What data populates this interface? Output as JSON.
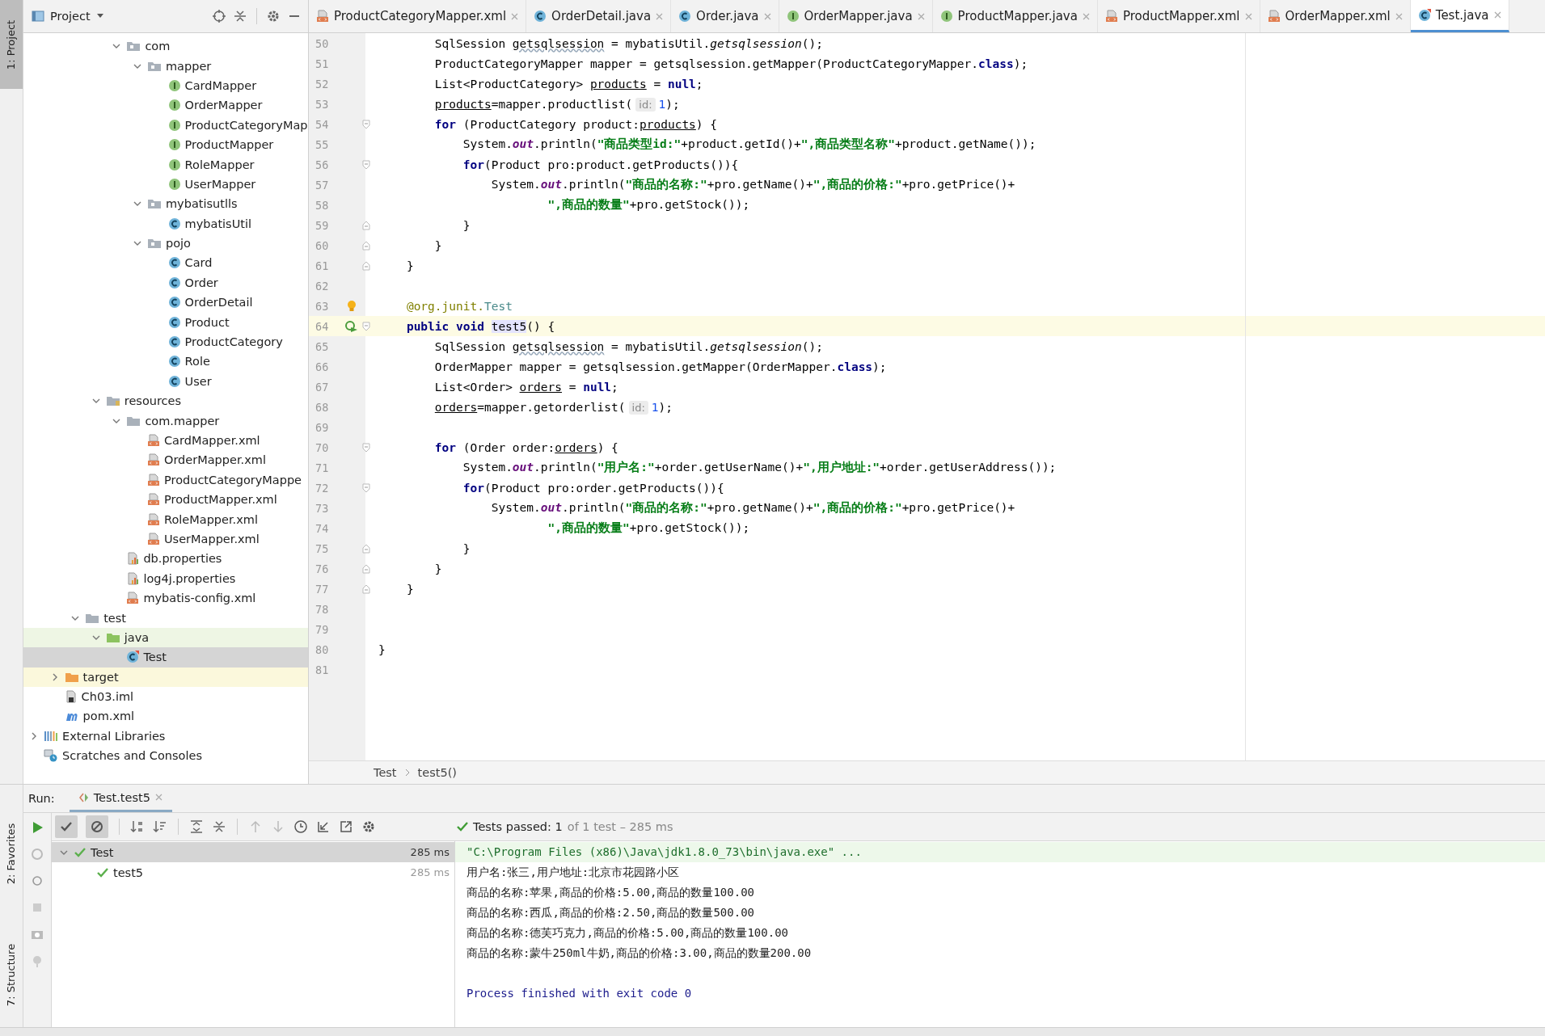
{
  "side_tabs": [
    {
      "label": "1: Project",
      "selected": true
    },
    {
      "label": "2: Favorites",
      "selected": false
    },
    {
      "label": "7: Structure",
      "selected": false
    }
  ],
  "project_panel": {
    "title": "Project",
    "tree": [
      {
        "children": [
          {
            "children": [
              {
                "children": [
                  {
                    "children": [
                      {
                        "label": "com",
                        "kind": "package",
                        "expanded": true,
                        "selected": false,
                        "children": [
                          {
                            "label": "mapper",
                            "kind": "package",
                            "expanded": true,
                            "selected": false,
                            "children": [
                              {
                                "label": "CardMapper",
                                "kind": "interface",
                                "selected": false
                              },
                              {
                                "label": "OrderMapper",
                                "kind": "interface",
                                "selected": false
                              },
                              {
                                "label": "ProductCategoryMap",
                                "kind": "interface",
                                "selected": false
                              },
                              {
                                "label": "ProductMapper",
                                "kind": "interface",
                                "selected": false
                              },
                              {
                                "label": "RoleMapper",
                                "kind": "interface",
                                "selected": false
                              },
                              {
                                "label": "UserMapper",
                                "kind": "interface",
                                "selected": false
                              }
                            ]
                          },
                          {
                            "label": "mybatisutlls",
                            "kind": "package",
                            "expanded": true,
                            "selected": false,
                            "children": [
                              {
                                "label": "mybatisUtil",
                                "kind": "class",
                                "selected": false
                              }
                            ]
                          },
                          {
                            "label": "pojo",
                            "kind": "package",
                            "expanded": true,
                            "selected": false,
                            "children": [
                              {
                                "label": "Card",
                                "kind": "class",
                                "selected": false
                              },
                              {
                                "label": "Order",
                                "kind": "class",
                                "selected": false
                              },
                              {
                                "label": "OrderDetail",
                                "kind": "class",
                                "selected": false
                              },
                              {
                                "label": "Product",
                                "kind": "class",
                                "selected": false
                              },
                              {
                                "label": "ProductCategory",
                                "kind": "class",
                                "selected": false
                              },
                              {
                                "label": "Role",
                                "kind": "class",
                                "selected": false
                              },
                              {
                                "label": "User",
                                "kind": "class",
                                "selected": false
                              }
                            ]
                          }
                        ]
                      }
                    ]
                  },
                  {
                    "label": "resources",
                    "kind": "resources",
                    "expanded": true,
                    "selected": false,
                    "children": [
                      {
                        "label": "com.mapper",
                        "kind": "folder",
                        "expanded": true,
                        "selected": false,
                        "children": [
                          {
                            "label": "CardMapper.xml",
                            "kind": "xml",
                            "selected": false
                          },
                          {
                            "label": "OrderMapper.xml",
                            "kind": "xml",
                            "selected": false
                          },
                          {
                            "label": "ProductCategoryMappe",
                            "kind": "xml",
                            "selected": false
                          },
                          {
                            "label": "ProductMapper.xml",
                            "kind": "xml",
                            "selected": false
                          },
                          {
                            "label": "RoleMapper.xml",
                            "kind": "xml",
                            "selected": false
                          },
                          {
                            "label": "UserMapper.xml",
                            "kind": "xml",
                            "selected": false
                          }
                        ]
                      },
                      {
                        "label": "db.properties",
                        "kind": "properties",
                        "selected": false
                      },
                      {
                        "label": "log4j.properties",
                        "kind": "properties",
                        "selected": false
                      },
                      {
                        "label": "mybatis-config.xml",
                        "kind": "xml",
                        "selected": false
                      }
                    ]
                  }
                ]
              },
              {
                "label": "test",
                "kind": "folder",
                "expanded": true,
                "selected": false,
                "children": [
                  {
                    "label": "java",
                    "kind": "test-root",
                    "expanded": true,
                    "selected": false,
                    "children": [
                      {
                        "label": "Test",
                        "kind": "test-class",
                        "selected": true
                      }
                    ]
                  }
                ]
              }
            ]
          },
          {
            "label": "target",
            "kind": "excluded",
            "expanded": false,
            "selected": false
          },
          {
            "label": "Ch03.iml",
            "kind": "iml",
            "selected": false
          },
          {
            "label": "pom.xml",
            "kind": "maven",
            "selected": false
          }
        ]
      },
      {
        "label": "External Libraries",
        "kind": "libraries",
        "expanded": false,
        "selected": false
      },
      {
        "label": "Scratches and Consoles",
        "kind": "scratches",
        "selected": false
      }
    ]
  },
  "editor_tabs": [
    {
      "label": "ProductCategoryMapper.xml",
      "kind": "xml",
      "selected": false
    },
    {
      "label": "OrderDetail.java",
      "kind": "class",
      "selected": false
    },
    {
      "label": "Order.java",
      "kind": "class",
      "selected": false
    },
    {
      "label": "OrderMapper.java",
      "kind": "interface",
      "selected": false
    },
    {
      "label": "ProductMapper.java",
      "kind": "interface",
      "selected": false
    },
    {
      "label": "ProductMapper.xml",
      "kind": "xml",
      "selected": false
    },
    {
      "label": "OrderMapper.xml",
      "kind": "xml",
      "selected": false
    },
    {
      "label": "Test.java",
      "kind": "test-class",
      "selected": true
    }
  ],
  "code_lines": [
    {
      "number": "50",
      "current": false,
      "tokens": [
        {
          "kind": "plain",
          "text": "        SqlSession "
        },
        {
          "kind": "wavy",
          "text": "getsqlsession"
        },
        {
          "kind": "plain",
          "text": " = mybatisUtil."
        },
        {
          "kind": "static",
          "text": "getsqlsession"
        },
        {
          "kind": "plain",
          "text": "();"
        }
      ]
    },
    {
      "number": "51",
      "current": false,
      "tokens": [
        {
          "kind": "plain",
          "text": "        ProductCategoryMapper mapper = getsqlsession.getMapper(ProductCategoryMapper."
        },
        {
          "kind": "keyword",
          "text": "class"
        },
        {
          "kind": "plain",
          "text": ");"
        }
      ]
    },
    {
      "number": "52",
      "current": false,
      "tokens": [
        {
          "kind": "plain",
          "text": "        List<ProductCategory> "
        },
        {
          "kind": "underline",
          "text": "products"
        },
        {
          "kind": "plain",
          "text": " = "
        },
        {
          "kind": "keyword",
          "text": "null"
        },
        {
          "kind": "plain",
          "text": ";"
        }
      ]
    },
    {
      "number": "53",
      "current": false,
      "tokens": [
        {
          "kind": "underline",
          "text": "        products"
        },
        {
          "kind": "plain",
          "text": "=mapper.productlist("
        },
        {
          "kind": "hint",
          "text": "id:"
        },
        {
          "kind": "number",
          "text": "1"
        },
        {
          "kind": "plain",
          "text": ");"
        }
      ]
    },
    {
      "number": "54",
      "current": false,
      "fold": {
        "kind": "open"
      },
      "tokens": [
        {
          "kind": "keyword",
          "text": "        for"
        },
        {
          "kind": "plain",
          "text": " (ProductCategory product:"
        },
        {
          "kind": "underline",
          "text": "products"
        },
        {
          "kind": "plain",
          "text": ") {"
        }
      ]
    },
    {
      "number": "55",
      "current": false,
      "tokens": [
        {
          "kind": "plain",
          "text": "            System."
        },
        {
          "kind": "field",
          "text": "out"
        },
        {
          "kind": "plain",
          "text": ".println("
        },
        {
          "kind": "string",
          "text": "\"商品类型id:\""
        },
        {
          "kind": "plain",
          "text": "+product.getId()+"
        },
        {
          "kind": "string",
          "text": "\",商品类型名称\""
        },
        {
          "kind": "plain",
          "text": "+product.getName());"
        }
      ]
    },
    {
      "number": "56",
      "current": false,
      "fold": {
        "kind": "open"
      },
      "tokens": [
        {
          "kind": "keyword",
          "text": "            for"
        },
        {
          "kind": "plain",
          "text": "(Product pro:product.getProducts()){"
        }
      ]
    },
    {
      "number": "57",
      "current": false,
      "tokens": [
        {
          "kind": "plain",
          "text": "                System."
        },
        {
          "kind": "field",
          "text": "out"
        },
        {
          "kind": "plain",
          "text": ".println("
        },
        {
          "kind": "string",
          "text": "\"商品的名称:\""
        },
        {
          "kind": "plain",
          "text": "+pro.getName()+"
        },
        {
          "kind": "string",
          "text": "\",商品的价格:\""
        },
        {
          "kind": "plain",
          "text": "+pro.getPrice()+"
        }
      ]
    },
    {
      "number": "58",
      "current": false,
      "tokens": [
        {
          "kind": "string",
          "text": "                        \",商品的数量\""
        },
        {
          "kind": "plain",
          "text": "+pro.getStock());"
        }
      ]
    },
    {
      "number": "59",
      "current": false,
      "fold": {
        "kind": "close"
      },
      "tokens": [
        {
          "kind": "plain",
          "text": "            }"
        }
      ]
    },
    {
      "number": "60",
      "current": false,
      "fold": {
        "kind": "close"
      },
      "tokens": [
        {
          "kind": "plain",
          "text": "        }"
        }
      ]
    },
    {
      "number": "61",
      "current": false,
      "fold": {
        "kind": "close"
      },
      "tokens": [
        {
          "kind": "plain",
          "text": "    }"
        }
      ]
    },
    {
      "number": "62",
      "current": false
    },
    {
      "number": "63",
      "current": false,
      "marker": {
        "kind": "bulb"
      },
      "tokens": [
        {
          "kind": "annotation",
          "text": "    @org.junit."
        },
        {
          "kind": "annotype",
          "text": "Test"
        }
      ]
    },
    {
      "number": "64",
      "current": true,
      "marker": {
        "kind": "run"
      },
      "fold": {
        "kind": "open"
      },
      "tokens": [
        {
          "kind": "keyword",
          "text": "    public void"
        },
        {
          "kind": "highlight",
          "text": " test5"
        },
        {
          "kind": "plain",
          "text": "() {"
        }
      ]
    },
    {
      "number": "65",
      "current": false,
      "tokens": [
        {
          "kind": "plain",
          "text": "        SqlSession "
        },
        {
          "kind": "wavy",
          "text": "getsqlsession"
        },
        {
          "kind": "plain",
          "text": " = mybatisUtil."
        },
        {
          "kind": "static",
          "text": "getsqlsession"
        },
        {
          "kind": "plain",
          "text": "();"
        }
      ]
    },
    {
      "number": "66",
      "current": false,
      "tokens": [
        {
          "kind": "plain",
          "text": "        OrderMapper mapper = getsqlsession.getMapper(OrderMapper."
        },
        {
          "kind": "keyword",
          "text": "class"
        },
        {
          "kind": "plain",
          "text": ");"
        }
      ]
    },
    {
      "number": "67",
      "current": false,
      "tokens": [
        {
          "kind": "plain",
          "text": "        List<Order> "
        },
        {
          "kind": "underline",
          "text": "orders"
        },
        {
          "kind": "plain",
          "text": " = "
        },
        {
          "kind": "keyword",
          "text": "null"
        },
        {
          "kind": "plain",
          "text": ";"
        }
      ]
    },
    {
      "number": "68",
      "current": false,
      "tokens": [
        {
          "kind": "underline",
          "text": "        orders"
        },
        {
          "kind": "plain",
          "text": "=mapper.getorderlist("
        },
        {
          "kind": "hint",
          "text": "id:"
        },
        {
          "kind": "number",
          "text": "1"
        },
        {
          "kind": "plain",
          "text": ");"
        }
      ]
    },
    {
      "number": "69",
      "current": false
    },
    {
      "number": "70",
      "current": false,
      "fold": {
        "kind": "open"
      },
      "tokens": [
        {
          "kind": "keyword",
          "text": "        for"
        },
        {
          "kind": "plain",
          "text": " (Order order:"
        },
        {
          "kind": "underline",
          "text": "orders"
        },
        {
          "kind": "plain",
          "text": ") {"
        }
      ]
    },
    {
      "number": "71",
      "current": false,
      "tokens": [
        {
          "kind": "plain",
          "text": "            System."
        },
        {
          "kind": "field",
          "text": "out"
        },
        {
          "kind": "plain",
          "text": ".println("
        },
        {
          "kind": "string",
          "text": "\"用户名:\""
        },
        {
          "kind": "plain",
          "text": "+order.getUserName()+"
        },
        {
          "kind": "string",
          "text": "\",用户地址:\""
        },
        {
          "kind": "plain",
          "text": "+order.getUserAddress());"
        }
      ]
    },
    {
      "number": "72",
      "current": false,
      "fold": {
        "kind": "open"
      },
      "tokens": [
        {
          "kind": "keyword",
          "text": "            for"
        },
        {
          "kind": "plain",
          "text": "(Product pro:order.getProducts()){"
        }
      ]
    },
    {
      "number": "73",
      "current": false,
      "tokens": [
        {
          "kind": "plain",
          "text": "                System."
        },
        {
          "kind": "field",
          "text": "out"
        },
        {
          "kind": "plain",
          "text": ".println("
        },
        {
          "kind": "string",
          "text": "\"商品的名称:\""
        },
        {
          "kind": "plain",
          "text": "+pro.getName()+"
        },
        {
          "kind": "string",
          "text": "\",商品的价格:\""
        },
        {
          "kind": "plain",
          "text": "+pro.getPrice()+"
        }
      ]
    },
    {
      "number": "74",
      "current": false,
      "tokens": [
        {
          "kind": "string",
          "text": "                        \",商品的数量\""
        },
        {
          "kind": "plain",
          "text": "+pro.getStock());"
        }
      ]
    },
    {
      "number": "75",
      "current": false,
      "fold": {
        "kind": "close"
      },
      "tokens": [
        {
          "kind": "plain",
          "text": "            }"
        }
      ]
    },
    {
      "number": "76",
      "current": false,
      "fold": {
        "kind": "close"
      },
      "tokens": [
        {
          "kind": "plain",
          "text": "        }"
        }
      ]
    },
    {
      "number": "77",
      "current": false,
      "fold": {
        "kind": "close"
      },
      "tokens": [
        {
          "kind": "plain",
          "text": "    }"
        }
      ]
    },
    {
      "number": "78",
      "current": false
    },
    {
      "number": "79",
      "current": false
    },
    {
      "number": "80",
      "current": false,
      "tokens": [
        {
          "kind": "plain",
          "text": "}"
        }
      ]
    },
    {
      "number": "81",
      "current": false
    }
  ],
  "breadcrumb": [
    "Test",
    "test5()"
  ],
  "run_panel": {
    "label": "Run:",
    "tab": "Test.test5",
    "toggles": [
      {
        "kind": "show-passed",
        "on": true
      },
      {
        "kind": "show-ignored",
        "on": true
      }
    ],
    "status": "Tests passed: 1",
    "status_detail": "of 1 test – 285 ms",
    "results": [
      {
        "label": "Test",
        "time": "285 ms",
        "selected": true,
        "expanded": true,
        "children": [
          {
            "label": "test5",
            "time": "285 ms",
            "selected": false
          }
        ]
      }
    ],
    "console": [
      {
        "kind": "command",
        "text": "\"C:\\Program Files (x86)\\Java\\jdk1.8.0_73\\bin\\java.exe\" ..."
      },
      {
        "kind": "output",
        "text": "用户名:张三,用户地址:北京市花园路小区"
      },
      {
        "kind": "output",
        "text": "商品的名称:苹果,商品的价格:5.00,商品的数量100.00"
      },
      {
        "kind": "output",
        "text": "商品的名称:西瓜,商品的价格:2.50,商品的数量500.00"
      },
      {
        "kind": "output",
        "text": "商品的名称:德芙巧克力,商品的价格:5.00,商品的数量100.00"
      },
      {
        "kind": "output",
        "text": "商品的名称:蒙牛250ml牛奶,商品的价格:3.00,商品的数量200.00"
      },
      {
        "kind": "exit",
        "text": "Process finished with exit code 0"
      }
    ]
  }
}
